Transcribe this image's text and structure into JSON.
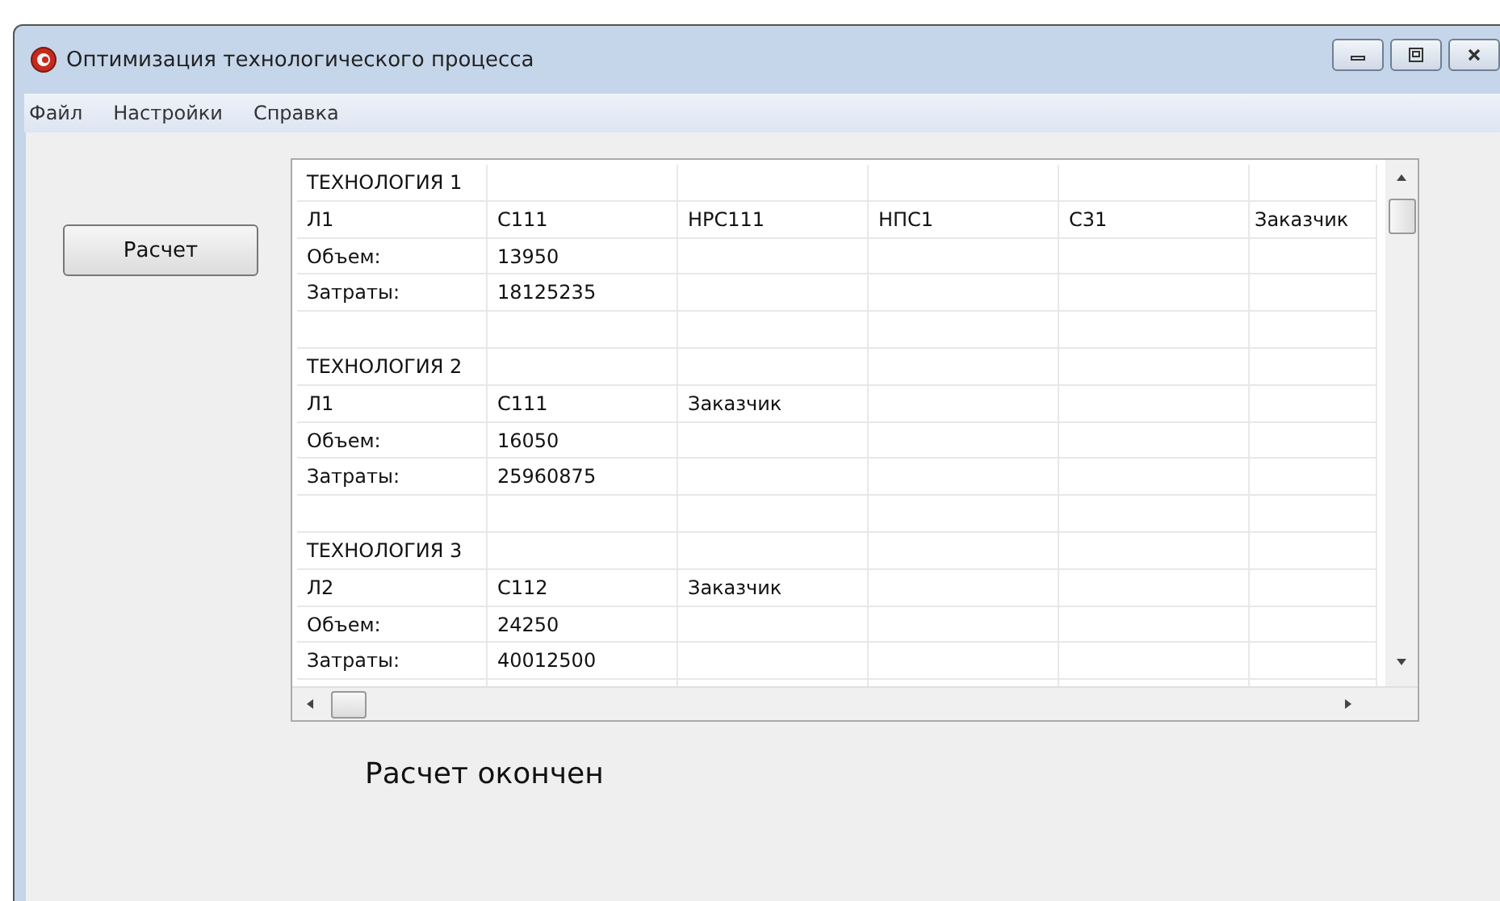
{
  "window": {
    "title": "Оптимизация технологического процесса"
  },
  "menu": [
    "Файл",
    "Настройки",
    "Справка"
  ],
  "button": {
    "label": "Расчет"
  },
  "grid": {
    "rows": [
      {
        "kind": "data",
        "cells": [
          "ТЕХНОЛОГИЯ 1"
        ]
      },
      {
        "kind": "data",
        "cells": [
          "Л1",
          "С111",
          "НРС111",
          "НПС1",
          "С31",
          "Заказчик"
        ]
      },
      {
        "kind": "data",
        "cells": [
          "Объем:",
          "13950"
        ]
      },
      {
        "kind": "data",
        "cells": [
          "Затраты:",
          "18125235"
        ]
      },
      {
        "kind": "blank"
      },
      {
        "kind": "data",
        "cells": [
          "ТЕХНОЛОГИЯ 2"
        ]
      },
      {
        "kind": "data",
        "cells": [
          "Л1",
          "С111",
          "Заказчик"
        ]
      },
      {
        "kind": "data",
        "cells": [
          "Объем:",
          "16050"
        ]
      },
      {
        "kind": "data",
        "cells": [
          "Затраты:",
          "25960875"
        ]
      },
      {
        "kind": "blank"
      },
      {
        "kind": "data",
        "cells": [
          "ТЕХНОЛОГИЯ 3"
        ]
      },
      {
        "kind": "data",
        "cells": [
          "Л2",
          "С112",
          "Заказчик"
        ]
      },
      {
        "kind": "data",
        "cells": [
          "Объем:",
          "24250"
        ]
      },
      {
        "kind": "data",
        "cells": [
          "Затраты:",
          "40012500"
        ]
      },
      {
        "kind": "blank"
      }
    ]
  },
  "status": "Расчет окончен"
}
